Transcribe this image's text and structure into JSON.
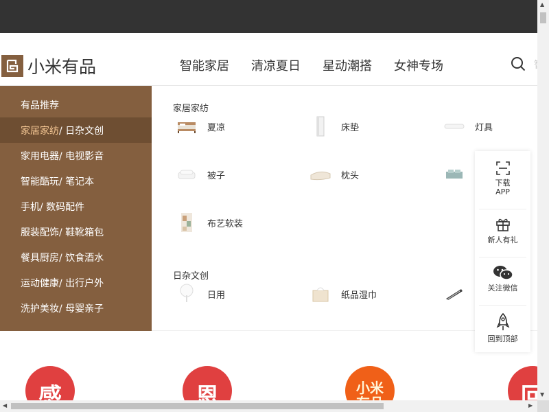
{
  "header": {
    "logo_text": "小米有品",
    "nav": [
      "智能家居",
      "清凉夏日",
      "星动潮搭",
      "女神专场"
    ],
    "search_placeholder_stub": "智"
  },
  "sidebar": {
    "items": [
      {
        "main": "有品推荐",
        "rest": ""
      },
      {
        "main": "家居家纺",
        "rest": " / 日杂文创"
      },
      {
        "main": "家用电器",
        "rest": " / 电视影音"
      },
      {
        "main": "智能酷玩",
        "rest": " / 笔记本"
      },
      {
        "main": "手机",
        "rest": " / 数码配件"
      },
      {
        "main": "服装配饰",
        "rest": " / 鞋靴箱包"
      },
      {
        "main": "餐具厨房",
        "rest": " / 饮食酒水"
      },
      {
        "main": "运动健康",
        "rest": " / 出行户外"
      },
      {
        "main": "洗护美妆",
        "rest": " / 母婴亲子"
      }
    ],
    "active_index": 1,
    "colors": {
      "bg": "#845f3f",
      "active_bg": "#6e4e32",
      "highlight": "#f6c895"
    }
  },
  "dropdown": {
    "sections": [
      {
        "title": "家居家纺",
        "products": [
          {
            "name": "夏凉",
            "icon": "bed-icon"
          },
          {
            "name": "床垫",
            "icon": "mattress-icon"
          },
          {
            "name": "灯具",
            "icon": "lamp-icon"
          },
          {
            "name": "被子",
            "icon": "quilt-icon"
          },
          {
            "name": "枕头",
            "icon": "pillow-icon"
          },
          {
            "name": "",
            "icon": "bedding-set-icon"
          },
          {
            "name": "布艺软装",
            "icon": "fabric-icon"
          }
        ]
      },
      {
        "title": "日杂文创",
        "products": [
          {
            "name": "日用",
            "icon": "fan-icon"
          },
          {
            "name": "纸品湿巾",
            "icon": "tissue-icon"
          },
          {
            "name": "",
            "icon": "umbrella-icon"
          }
        ]
      }
    ]
  },
  "float_bar": {
    "items": [
      {
        "label": "下载\nAPP",
        "icon": "scan-icon"
      },
      {
        "label": "新人有礼",
        "icon": "gift-icon"
      },
      {
        "label": "关注微信",
        "icon": "wechat-icon"
      },
      {
        "label": "回到顶部",
        "icon": "rocket-icon"
      }
    ]
  },
  "promos": [
    {
      "char": "感",
      "color": "#e04040"
    },
    {
      "char": "恩",
      "color": "#e04040"
    },
    {
      "char": "小米有品",
      "color": "#f06018"
    },
    {
      "char": "回",
      "color": "#e04040"
    }
  ]
}
